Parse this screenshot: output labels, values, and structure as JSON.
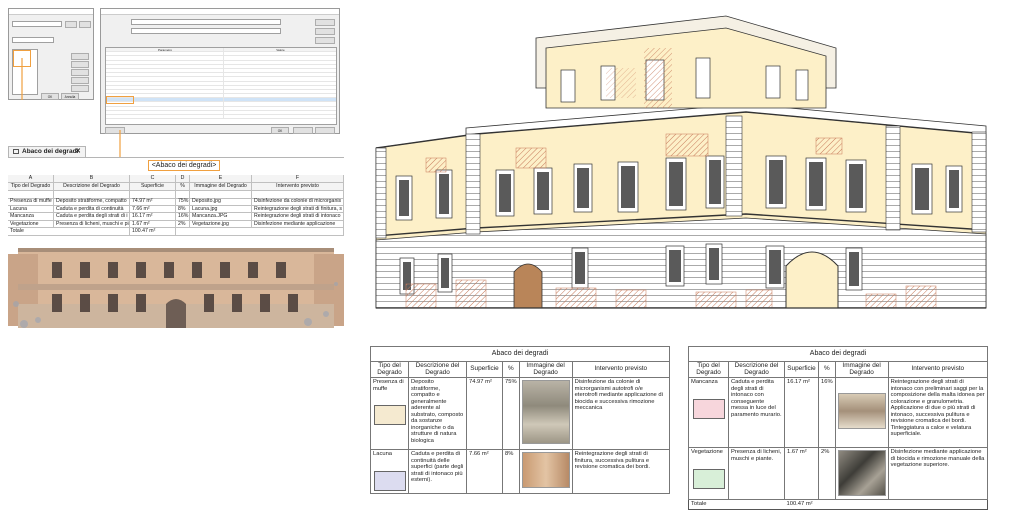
{
  "colors": {
    "highlight": "#f0a040",
    "facade_wall": "#fdf0c8",
    "degrado_hatch": "#c77a5a",
    "swatch_muffe": "#f5ead0",
    "swatch_lacuna": "#dcdcf0",
    "swatch_mancanza": "#f7d6dc",
    "swatch_vegetazione": "#d8efd8"
  },
  "dialog_fields": {
    "buttons": [
      "OK",
      "Annulla"
    ]
  },
  "dialog_props": {
    "header_parametro": "Parametro",
    "header_valore": "Valore",
    "ok_label": "OK"
  },
  "schedule": {
    "tab_label": "Abaco dei degradi",
    "close_icon": "✕",
    "title": "<Abaco dei degradi>",
    "columns": [
      "A",
      "B",
      "C",
      "D",
      "E",
      "F"
    ],
    "headers": [
      "Tipo del Degrado",
      "Descrizione del Degrado",
      "Superficie",
      "%",
      "Immagine del Degrado",
      "Intervento previsto"
    ],
    "rows": [
      [
        "Presenza di muffe",
        "Deposito stratiforme, compatto",
        "74.97 m²",
        "75%",
        "Deposito.jpg",
        "Disinfezione da colonie di microrganis"
      ],
      [
        "Lacuna",
        "Caduta e perdita di continuità",
        "7.66 m²",
        "8%",
        "Lacuna.jpg",
        "Reintegrazione degli strati di finitura, s"
      ],
      [
        "Mancanza",
        "Caduta e perdita degli strati di i",
        "16.17 m²",
        "16%",
        "Mancanza.JPG",
        "Reintegrazione degli strati di intonaco"
      ],
      [
        "Vegetazione",
        "Presenza di licheni, muschi e pia",
        "1.67 m²",
        "2%",
        "Vegetazione.jpg",
        "Disinfezione mediante applicazione"
      ]
    ],
    "total_label": "Totale",
    "total_value": "100.47 m²"
  },
  "paper_left": {
    "caption": "Abaco dei degradi",
    "headers": [
      "Tipo del Degrado",
      "Descrizione del Degrado",
      "Superficie",
      "%",
      "Immagine del Degrado",
      "Intervento previsto"
    ],
    "rows": [
      {
        "tipo": "Presenza di muffe",
        "descrizione": "Deposito stratiforme, compatto e generalmente aderente al substrato, composto da sostanze inorganiche o da strutture di natura biologica",
        "superficie": "74.97 m²",
        "perc": "75%",
        "intervento": "Disinfezione da colonie di microrganismi autotrofi o/e eterotrofi mediante applicazione di biocida e successiva rimozione meccanica"
      },
      {
        "tipo": "Lacuna",
        "descrizione": "Caduta e perdita di continuità delle superfici (parte degli strati di intonaco più esterni).",
        "superficie": "7.66 m²",
        "perc": "8%",
        "intervento": "Reintegrazione degli strati di finitura, successiva pulitura e revisione cromatica dei bordi."
      }
    ]
  },
  "paper_right": {
    "caption": "Abaco dei degradi",
    "headers": [
      "Tipo del Degrado",
      "Descrizione del Degrado",
      "Superficie",
      "%",
      "Immagine del Degrado",
      "Intervento previsto"
    ],
    "rows": [
      {
        "tipo": "Mancanza",
        "descrizione": "Caduta e perdita degli strati di intonaco con conseguente messa in luce del paramento murario.",
        "superficie": "16.17 m²",
        "perc": "16%",
        "intervento": "Reintegrazione degli strati di intonaco con preliminari saggi per la composizione della malta idonea per colorazione e granulometria. Applicazione di due o più strati di intonaco, successiva pulitura e revisione cromatica dei bordi. Tinteggiatura a calce e velatura superficiale."
      },
      {
        "tipo": "Vegetazione",
        "descrizione": "Presenza di licheni, muschi e piante.",
        "superficie": "1.67 m²",
        "perc": "2%",
        "intervento": "Disinfezione mediante applicazione di biocida e rimozione manuale della vegetazione superiore."
      }
    ],
    "total_label": "Totale",
    "total_value": "100.47 m²"
  }
}
